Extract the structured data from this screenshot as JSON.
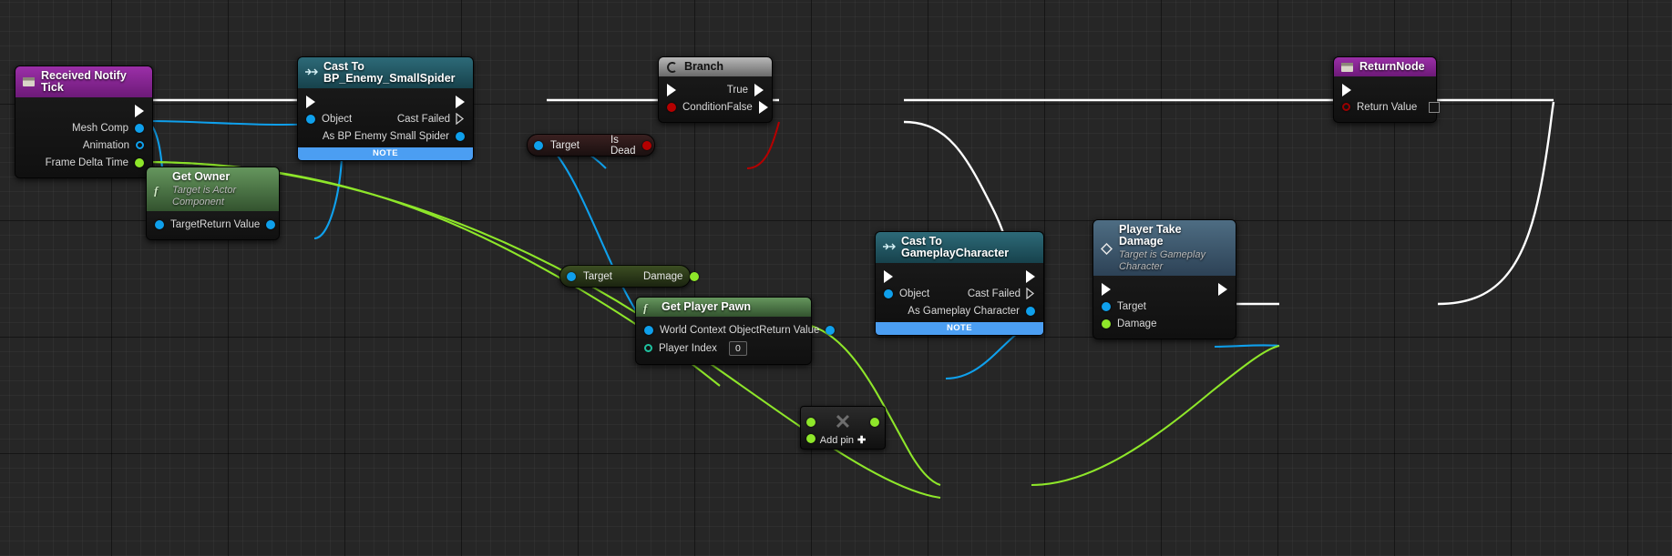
{
  "graph": {
    "title": "Blueprint Event Graph",
    "colors": {
      "exec_wire": "#ffffff",
      "object_wire": "#0fa0ec",
      "real_wire": "#8ee62a",
      "bool_wire": "#b40000",
      "note_bar": "#4b9ef2"
    }
  },
  "nodes": {
    "received_notify_tick": {
      "title": "Received Notify Tick",
      "icon": "event-icon",
      "pins": [
        {
          "label": "",
          "kind": "exec-out"
        },
        {
          "label": "Mesh Comp",
          "kind": "object-out"
        },
        {
          "label": "Animation",
          "kind": "object-out-hollow"
        },
        {
          "label": "Frame Delta Time",
          "kind": "real-out"
        }
      ]
    },
    "get_owner": {
      "title": "Get Owner",
      "subtitle": "Target is Actor Component",
      "icon": "function-icon",
      "input_label": "Target",
      "output_label": "Return Value"
    },
    "cast_to_bp_enemy_smallspider": {
      "title": "Cast To BP_Enemy_SmallSpider",
      "icon": "cast-icon",
      "in_exec": "",
      "in_object": "Object",
      "out_exec": "",
      "out_cast_failed": "Cast Failed",
      "out_as": "As BP Enemy Small Spider",
      "note": "NOTE"
    },
    "is_dead": {
      "target_label": "Target",
      "output_label": "Is Dead"
    },
    "branch": {
      "title": "Branch",
      "icon": "branch-icon",
      "in_condition": "Condition",
      "out_true": "True",
      "out_false": "False"
    },
    "damage": {
      "target_label": "Target",
      "output_label": "Damage"
    },
    "get_player_pawn": {
      "title": "Get Player Pawn",
      "icon": "function-icon",
      "in_world_context": "World Context Object",
      "in_player_index": "Player Index",
      "player_index_value": "0",
      "out_return_value": "Return Value"
    },
    "cast_to_gameplaycharacter": {
      "title": "Cast To GameplayCharacter",
      "icon": "cast-icon",
      "in_object": "Object",
      "out_cast_failed": "Cast Failed",
      "out_as": "As Gameplay Character",
      "note": "NOTE"
    },
    "player_take_damage": {
      "title": "Player Take Damage",
      "subtitle": "Target is Gameplay Character",
      "icon": "native-event-icon",
      "in_target": "Target",
      "in_damage": "Damage"
    },
    "multiply": {
      "glyph": "✕",
      "add_pin_label": "Add pin",
      "add_pin_plus": "✚"
    },
    "return_node": {
      "title": "ReturnNode",
      "icon": "event-icon",
      "out_return_value": "Return Value"
    }
  }
}
